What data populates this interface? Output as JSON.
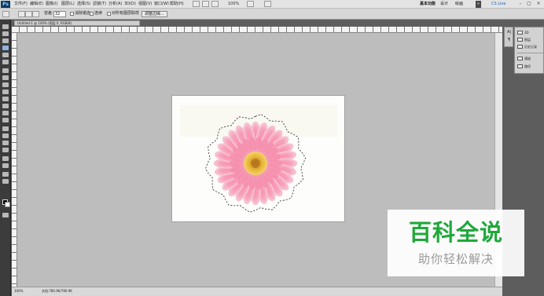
{
  "menubar": {
    "logo": "Ps",
    "items": [
      "文件(F)",
      "编辑(E)",
      "图像(I)",
      "图层(L)",
      "选择(S)",
      "滤镜(T)",
      "分析(A)",
      "3D(D)",
      "视图(V)",
      "窗口(W)",
      "帮助(H)"
    ],
    "zoom": "100%",
    "workspaces": [
      "基本功能",
      "设计",
      "绘画"
    ],
    "cs_live": "CS Live"
  },
  "options_bar": {
    "feather_label": "羽化:",
    "feather_value": "0 px",
    "antialias_label": "消除锯齿",
    "tolerance_label": "容差:",
    "tolerance_value": "32",
    "contiguous_label": "连续",
    "sample_all_label": "对所有图层取样",
    "refine_edge_button": "调整边缘..."
  },
  "document": {
    "tab_title": "Untitled-1 @ 100% (图层 0, RGB/8)",
    "status_zoom": "100%",
    "status_doc": "文档:780.9K/780.9K"
  },
  "panels": {
    "col1_icons": [
      "A|",
      "¶"
    ],
    "items": [
      {
        "label": "3D",
        "icon": "3d-icon"
      },
      {
        "label": "图层",
        "icon": "layers-icon"
      },
      {
        "label": "历史记录",
        "icon": "history-icon"
      },
      {
        "label": "通道",
        "icon": "channels-icon"
      },
      {
        "label": "路径",
        "icon": "paths-icon"
      }
    ]
  },
  "watermark": {
    "title": "百科全说",
    "subtitle": "助你轻松解决"
  },
  "colors": {
    "watermark_green": "#1fa83a",
    "flower_pink": "#f2a9bd",
    "flower_center": "#e8b63a"
  }
}
